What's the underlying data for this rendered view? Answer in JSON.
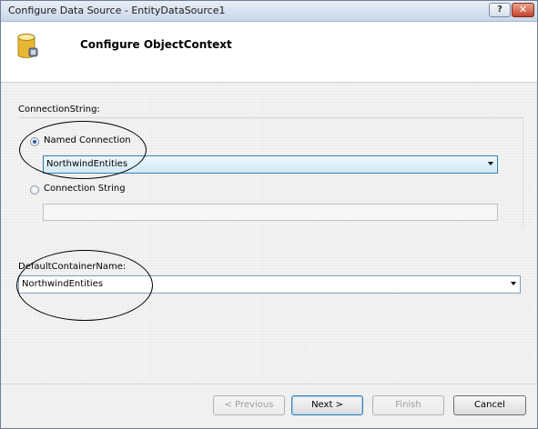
{
  "window": {
    "title": "Configure Data Source - EntityDataSource1",
    "help_label": "?",
    "close_label": "✕"
  },
  "header": {
    "heading": "Configure ObjectContext",
    "icon": "database-icon"
  },
  "connection": {
    "label": "ConnectionString:",
    "named_option_label": "Named Connection",
    "named_selected": true,
    "named_value": "NorthwindEntities",
    "string_option_label": "Connection String",
    "string_value": ""
  },
  "container": {
    "label": "DefaultContainerName:",
    "value": "NorthwindEntities"
  },
  "buttons": {
    "previous": "< Previous",
    "next": "Next >",
    "finish": "Finish",
    "cancel": "Cancel"
  },
  "colors": {
    "title_bar": "#c9d6e8",
    "close_button": "#c2412b",
    "focus_border": "#3c7fb1"
  }
}
